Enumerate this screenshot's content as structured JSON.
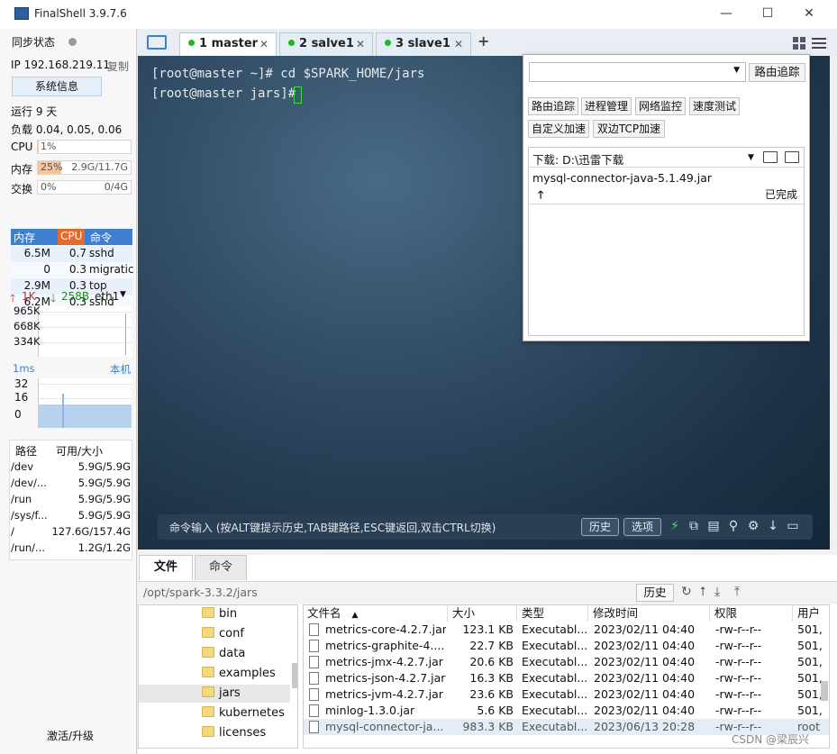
{
  "window": {
    "title": "FinalShell 3.9.7.6",
    "minimize": "—",
    "maximize": "☐",
    "close": "✕"
  },
  "sidebar": {
    "sync_label": "同步状态",
    "ip": "IP 192.168.219.11",
    "copy": "复制",
    "sysinfo_button": "系统信息",
    "uptime": "运行 9 天",
    "load": "负载 0.04, 0.05, 0.06",
    "cpu_label": "CPU",
    "cpu_value": "1%",
    "cpu_level": 0.01,
    "mem_label": "内存",
    "mem_percent": "25%",
    "mem_value": "2.9G/11.7G",
    "mem_level": 0.25,
    "swap_label": "交换",
    "swap_percent": "0%",
    "swap_value": "0/4G",
    "proc_headers": [
      "内存",
      "CPU",
      "命令"
    ],
    "processes": [
      {
        "mem": "6.5M",
        "cpu": "0.7",
        "cmd": "sshd"
      },
      {
        "mem": "0",
        "cpu": "0.3",
        "cmd": "migratic"
      },
      {
        "mem": "2.9M",
        "cpu": "0.3",
        "cmd": "top"
      },
      {
        "mem": "6.2M",
        "cpu": "0.3",
        "cmd": "sshd"
      }
    ],
    "net_up": "1K",
    "net_down": "258B",
    "net_iface": "eth1",
    "net_scale": [
      "965K",
      "668K",
      "334K"
    ],
    "ping_label": "1ms",
    "ping_host": "本机",
    "ping_scale": [
      "32",
      "16",
      "0"
    ],
    "disk_headers": [
      "路径",
      "可用/大小"
    ],
    "disks": [
      {
        "path": "/dev",
        "size": "5.9G/5.9G"
      },
      {
        "path": "/dev/...",
        "size": "5.9G/5.9G"
      },
      {
        "path": "/run",
        "size": "5.9G/5.9G"
      },
      {
        "path": "/sys/f...",
        "size": "5.9G/5.9G"
      },
      {
        "path": "/",
        "size": "127.6G/157.4G"
      },
      {
        "path": "/run/...",
        "size": "1.2G/1.2G"
      }
    ],
    "activate": "激活/升级"
  },
  "tabs": [
    {
      "label": "1 master",
      "active": true
    },
    {
      "label": "2 salve1",
      "active": false
    },
    {
      "label": "3 slave1",
      "active": false
    }
  ],
  "tab_add": "+",
  "terminal": {
    "lines": [
      "[root@master ~]# cd $SPARK_HOME/jars",
      "[root@master jars]# "
    ],
    "cmd_hint": "命令输入 (按ALT键提示历史,TAB键路径,ESC键返回,双击CTRL切换)",
    "history_btn": "历史",
    "options_btn": "选项"
  },
  "popup": {
    "route_btn": "路由追踪",
    "tools": [
      "路由追踪",
      "进程管理",
      "网络监控",
      "速度测试",
      "自定义加速",
      "双边TCP加速"
    ],
    "download_label": "下载: D:\\迅雷下载",
    "download_file": "mysql-connector-java-5.1.49.jar",
    "download_status": "已完成"
  },
  "bottom": {
    "tabs": [
      "文件",
      "命令"
    ],
    "path": "/opt/spark-3.3.2/jars",
    "history_btn": "历史",
    "tree": [
      "bin",
      "conf",
      "data",
      "examples",
      "jars",
      "kubernetes",
      "licenses"
    ],
    "file_headers": [
      "文件名",
      "大小",
      "类型",
      "修改时间",
      "权限",
      "用户"
    ],
    "files": [
      {
        "name": "metrics-core-4.2.7.jar",
        "size": "123.1 KB",
        "type": "Executabl...",
        "mtime": "2023/02/11 04:40",
        "perm": "-rw-r--r--",
        "user": "501,"
      },
      {
        "name": "metrics-graphite-4....",
        "size": "22.7 KB",
        "type": "Executabl...",
        "mtime": "2023/02/11 04:40",
        "perm": "-rw-r--r--",
        "user": "501,"
      },
      {
        "name": "metrics-jmx-4.2.7.jar",
        "size": "20.6 KB",
        "type": "Executabl...",
        "mtime": "2023/02/11 04:40",
        "perm": "-rw-r--r--",
        "user": "501,"
      },
      {
        "name": "metrics-json-4.2.7.jar",
        "size": "16.3 KB",
        "type": "Executabl...",
        "mtime": "2023/02/11 04:40",
        "perm": "-rw-r--r--",
        "user": "501,"
      },
      {
        "name": "metrics-jvm-4.2.7.jar",
        "size": "23.6 KB",
        "type": "Executabl...",
        "mtime": "2023/02/11 04:40",
        "perm": "-rw-r--r--",
        "user": "501,"
      },
      {
        "name": "minlog-1.3.0.jar",
        "size": "5.6 KB",
        "type": "Executabl...",
        "mtime": "2023/02/11 04:40",
        "perm": "-rw-r--r--",
        "user": "501,"
      },
      {
        "name": "mysql-connector-ja...",
        "size": "983.3 KB",
        "type": "Executabl...",
        "mtime": "2023/06/13 20:28",
        "perm": "-rw-r--r--",
        "user": "root"
      }
    ]
  },
  "watermark": "CSDN @梁辰兴"
}
